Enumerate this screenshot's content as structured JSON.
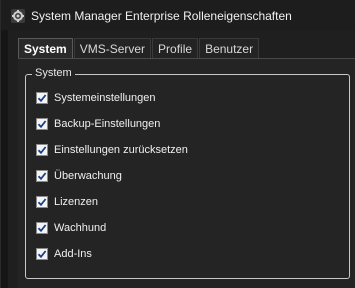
{
  "window": {
    "title": "System Manager Enterprise Rolleneigenschaften",
    "icon": "gear-app-icon"
  },
  "tabs": [
    {
      "label": "System",
      "active": true
    },
    {
      "label": "VMS-Server",
      "active": false
    },
    {
      "label": "Profile",
      "active": false
    },
    {
      "label": "Benutzer",
      "active": false
    }
  ],
  "group": {
    "label": "System",
    "items": [
      {
        "label": "Systemeinstellungen",
        "checked": true
      },
      {
        "label": "Backup-Einstellungen",
        "checked": true
      },
      {
        "label": "Einstellungen zurücksetzen",
        "checked": true
      },
      {
        "label": "Überwachung",
        "checked": true
      },
      {
        "label": "Lizenzen",
        "checked": true
      },
      {
        "label": "Wachhund",
        "checked": true
      },
      {
        "label": "Add-Ins",
        "checked": true
      }
    ]
  },
  "colors": {
    "background": "#1f1f1f",
    "panel": "#242424",
    "text": "#f0f0f0",
    "checkmark": "#1a3f8a"
  }
}
